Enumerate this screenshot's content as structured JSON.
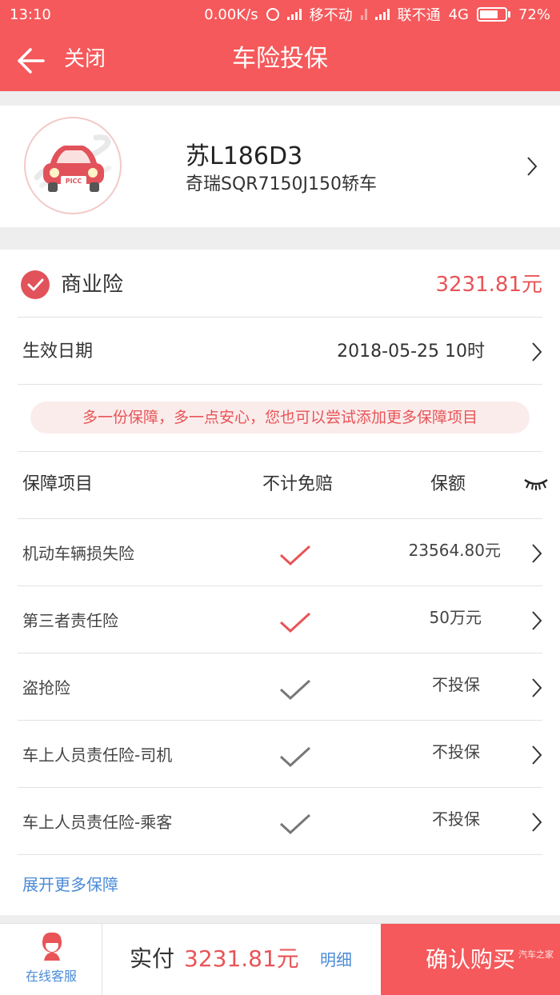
{
  "status_bar": {
    "time": "13:10",
    "net_speed": "0.00K/s",
    "carrier1": "移不动",
    "carrier2": "联不通",
    "network": "4G",
    "battery": "72%"
  },
  "navbar": {
    "close_label": "关闭",
    "title": "车险投保"
  },
  "vehicle": {
    "logo_text": "PICC",
    "plate": "苏L186D3",
    "model": "奇瑞SQR7150J150轿车"
  },
  "commercial": {
    "label": "商业险",
    "price": "3231.81元",
    "accent_color": "#e85457"
  },
  "effective": {
    "label": "生效日期",
    "value": "2018-05-25 10时"
  },
  "tip": "多一份保障，多一点安心，您也可以尝试添加更多保障项目",
  "table_header": {
    "item": "保障项目",
    "no_deductible": "不计免赔",
    "amount": "保额"
  },
  "coverages": [
    {
      "name": "机动车辆损失险",
      "checked": true,
      "amount": "23564.80元"
    },
    {
      "name": "第三者责任险",
      "checked": true,
      "amount": "50万元"
    },
    {
      "name": "盗抢险",
      "checked": false,
      "amount": "不投保"
    },
    {
      "name": "车上人员责任险-司机",
      "checked": false,
      "amount": "不投保"
    },
    {
      "name": "车上人员责任险-乘客",
      "checked": false,
      "amount": "不投保"
    }
  ],
  "expand_label": "展开更多保障",
  "bottom": {
    "service_label": "在线客服",
    "pay_prefix": "实付",
    "pay_amount": "3231.81元",
    "detail_label": "明细",
    "buy_label": "确认购买",
    "watermark": "汽车之家"
  }
}
